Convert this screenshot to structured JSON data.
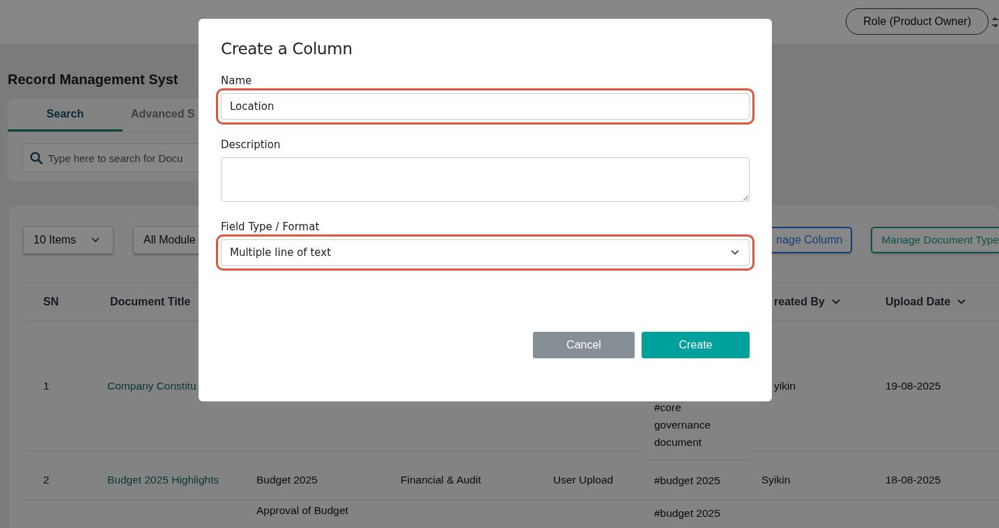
{
  "header": {
    "role_button": "Role (Product Owner)"
  },
  "page_title": "Record Management Syst",
  "tabs": [
    {
      "label": "Search",
      "selected": true
    },
    {
      "label": "Advanced S",
      "selected": false
    }
  ],
  "search": {
    "placeholder": "Type here to search for Docu"
  },
  "toolbar": {
    "dropdowns": [
      {
        "label": "10 Items",
        "chevron": true
      },
      {
        "label": "All Module",
        "chevron": false
      }
    ],
    "buttons": [
      {
        "label": "nage Column",
        "kind": "outline-primary"
      },
      {
        "label": "Manage Document Type",
        "kind": "outline-success"
      }
    ]
  },
  "table": {
    "header": {
      "sn": {
        "label": "SN",
        "sortable": false
      },
      "title": {
        "label": "Document Title",
        "sortable": false
      },
      "created_by": {
        "label": "reated By",
        "sortable": true
      },
      "upload_date": {
        "label": "Upload Date",
        "sortable": true
      }
    },
    "rows": [
      {
        "sn": "1",
        "title": "Company Constitu",
        "column_6": "#core governance document",
        "created_by": "yikin",
        "upload_date": "19-08-2025"
      },
      {
        "sn": "2",
        "title": "Budget 2025 Highlights",
        "column_3": "Budget 2025",
        "column_4": "Financial & Audit",
        "column_5": "User Upload",
        "column_6": "#budget 2025",
        "created_by": "Syikin",
        "upload_date": "18-08-2025"
      },
      {
        "column_3": "Approval of Budget",
        "column_6": "#budget 2025"
      }
    ]
  },
  "dialog": {
    "title": "Create a Column",
    "fields": [
      {
        "label": "Name",
        "kind": "text",
        "value": "Location",
        "highlighted": true
      },
      {
        "label": "Description",
        "kind": "textarea",
        "highlighted": false
      },
      {
        "label": "Field Type / Format",
        "kind": "select",
        "value": "Multiple line of text",
        "highlighted": true
      }
    ],
    "buttons": [
      {
        "label": "Cancel",
        "kind": "secondary"
      },
      {
        "label": "Create",
        "kind": "primary"
      }
    ]
  }
}
